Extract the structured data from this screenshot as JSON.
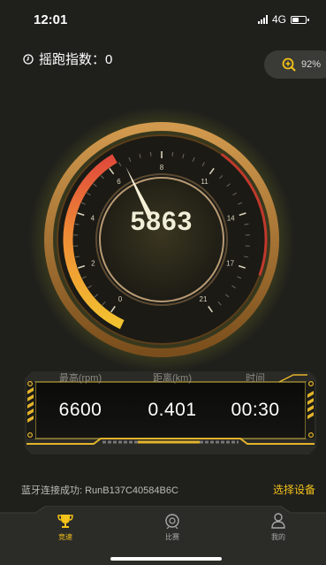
{
  "status_bar": {
    "time": "12:01",
    "network": "4G",
    "battery_level": 0.5
  },
  "header": {
    "index_label": "摇跑指数：0",
    "zoom_value": "92%"
  },
  "gauge": {
    "speed_value": "5863",
    "ticks": [
      "0",
      "2",
      "4",
      "6",
      "8",
      "11",
      "14",
      "17",
      "21"
    ],
    "needle_tick": "6"
  },
  "stats": [
    {
      "label": "最高(rpm)",
      "value": "6600"
    },
    {
      "label": "距离(km)",
      "value": "0.401"
    },
    {
      "label": "时间",
      "value": "00:30"
    }
  ],
  "bluetooth": {
    "status": "蓝牙连接成功: RunB137C40584B6C",
    "select_label": "选择设备"
  },
  "nav": {
    "items": [
      {
        "label": "竞速",
        "icon": "trophy-icon",
        "active": true
      },
      {
        "label": "比赛",
        "icon": "match-icon",
        "active": false
      },
      {
        "label": "我的",
        "icon": "user-icon",
        "active": false
      }
    ]
  },
  "colors": {
    "accent": "#f3c21a",
    "gauge_bronze": "#9a6b2c",
    "gauge_red": "#e04a3a"
  }
}
